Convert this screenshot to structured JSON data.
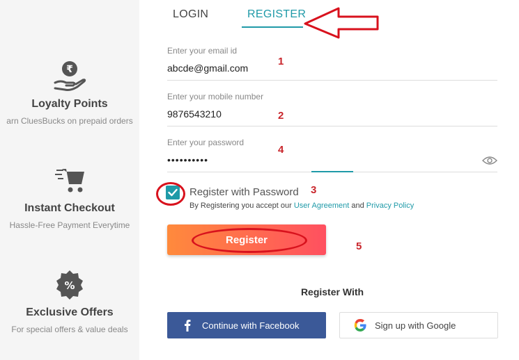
{
  "sidebar": {
    "features": [
      {
        "icon": "rupee-hand-icon",
        "title": "Loyalty Points",
        "subtitle": "arn CluesBucks on prepaid orders"
      },
      {
        "icon": "cart-icon",
        "title": "Instant Checkout",
        "subtitle": "Hassle-Free Payment Everytime"
      },
      {
        "icon": "percent-badge-icon",
        "title": "Exclusive Offers",
        "subtitle": "For special offers & value deals"
      }
    ]
  },
  "tabs": {
    "login": "LOGIN",
    "register": "REGISTER",
    "active": "register"
  },
  "form": {
    "email": {
      "label": "Enter your email id",
      "value": "abcde@gmail.com"
    },
    "mobile": {
      "label": "Enter your mobile number",
      "value": "9876543210"
    },
    "password": {
      "label": "Enter your password",
      "value": "••••••••••"
    },
    "register_with_password": {
      "label": "Register with Password",
      "checked": true
    },
    "terms": {
      "prefix": "By Registering you accept our",
      "agreement": "User Agreement",
      "and": "and",
      "privacy": "Privacy Policy"
    },
    "submit_label": "Register"
  },
  "social": {
    "heading": "Register With",
    "facebook_label": "Continue with Facebook",
    "google_label": "Sign up with Google"
  },
  "annotations": [
    "1",
    "2",
    "3",
    "4",
    "5"
  ],
  "colors": {
    "accent": "#1f9aa8",
    "facebook": "#3b5998",
    "annotation": "#d8121d",
    "button_gradient_start": "#ff8a3c",
    "button_gradient_end": "#ff5060"
  }
}
